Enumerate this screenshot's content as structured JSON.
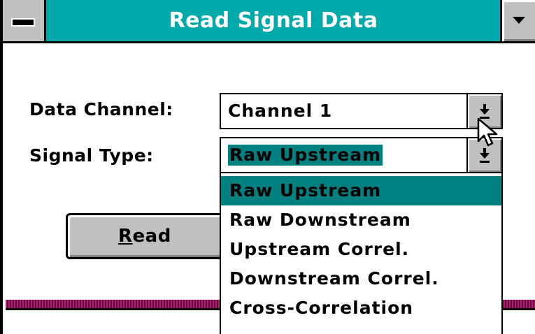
{
  "window": {
    "title": "Read Signal Data",
    "accent_color": "#00aaaa",
    "system_menu_icon": "minus-icon",
    "minimize_icon": "triangle-down-icon"
  },
  "form": {
    "data_channel_label": "Data Channel:",
    "data_channel_value": "Channel 1",
    "signal_type_label": "Signal Type:",
    "signal_type_value": "Raw Upstream",
    "dropdown_icon": "arrow-down-icon"
  },
  "dropdown": {
    "options": [
      "Raw Upstream",
      "Raw Downstream",
      "Upstream Correl.",
      "Downstream Correl.",
      "Cross-Correlation"
    ],
    "highlighted": "Raw Upstream",
    "highlight_color": "#008080"
  },
  "buttons": {
    "read_label": "Read"
  },
  "cursor": {
    "icon": "arrow-cursor-icon"
  }
}
